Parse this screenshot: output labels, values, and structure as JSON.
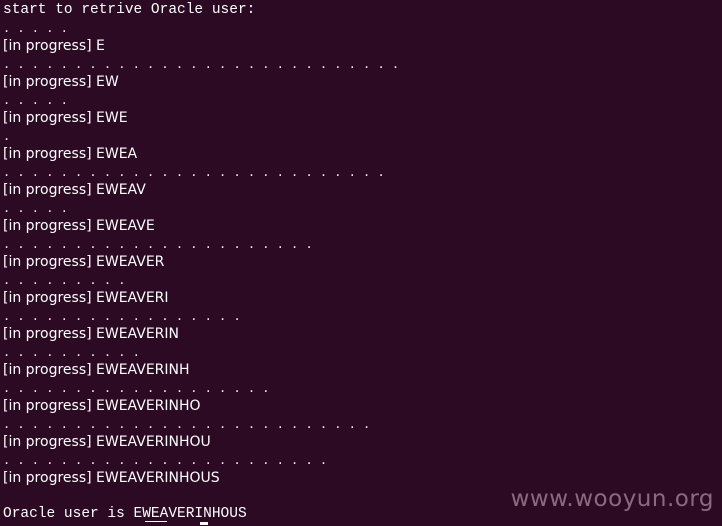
{
  "terminal": {
    "header": "start to retrive Oracle user:",
    "rows": [
      {
        "dots": ". . . . .",
        "progress": "[in progress] E"
      },
      {
        "dots": ". . . . . . . . . . . . . . . . . . . . . . . . . . . .",
        "progress": "[in progress] EW"
      },
      {
        "dots": ". . . . .",
        "progress": "[in progress] EWE"
      },
      {
        "dots": ".",
        "progress": "[in progress] EWEA"
      },
      {
        "dots": ". . . . . . . . . . . . . . . . . . . . . . . . . . .",
        "progress": "[in progress] EWEAV"
      },
      {
        "dots": ". . . . .",
        "progress": "[in progress] EWEAVE"
      },
      {
        "dots": ". . . . . . . . . . . . . . . . . . . . . .",
        "progress": "[in progress] EWEAVER"
      },
      {
        "dots": ". . . . . . . . .",
        "progress": "[in progress] EWEAVERI"
      },
      {
        "dots": ". . . . . . . . . . . . . . . . .",
        "progress": "[in progress] EWEAVERIN"
      },
      {
        "dots": ". . . . . . . . . .",
        "progress": "[in progress] EWEAVERINH"
      },
      {
        "dots": ". . . . . . . . . . . . . . . . . . .",
        "progress": "[in progress] EWEAVERINHO"
      },
      {
        "dots": ". . . . . . . . . . . . . . . . . . . . . . . . . .",
        "progress": "[in progress] EWEAVERINHOU"
      },
      {
        "dots": ". . . . . . . . . . . . . . . . . . . . . . .",
        "progress": "[in progress] EWEAVERINHOUS"
      }
    ],
    "result": "Oracle user is EWEAVERINHOUS"
  },
  "watermark": "www.wooyun.org",
  "colors": {
    "background": "#2c0a24",
    "text": "#ffffff",
    "watermark": "#8a6a80"
  }
}
